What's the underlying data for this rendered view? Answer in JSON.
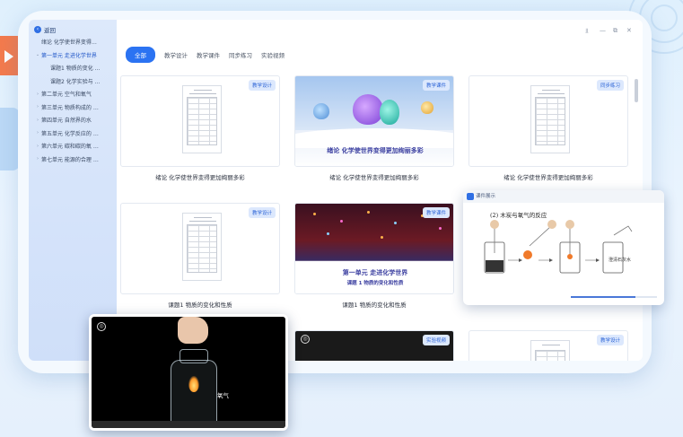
{
  "sidebar": {
    "back_label": "返回",
    "items": [
      {
        "label": "绪论 化学使世界变得…",
        "arrow": "",
        "active": false
      },
      {
        "label": "第一单元 走进化学世界",
        "arrow": "⌄",
        "active": true
      },
      {
        "label": "课题1 物质的变化 …",
        "arrow": "",
        "active": false
      },
      {
        "label": "课题2 化学实验与 …",
        "arrow": "",
        "active": false
      },
      {
        "label": "第二单元 空气和氧气",
        "arrow": "›",
        "active": false
      },
      {
        "label": "第三单元 物质构成的 …",
        "arrow": "›",
        "active": false
      },
      {
        "label": "第四单元 自然界的水",
        "arrow": "›",
        "active": false
      },
      {
        "label": "第五单元 化学反应的 …",
        "arrow": "›",
        "active": false
      },
      {
        "label": "第六单元 碳和碳的氧 …",
        "arrow": "›",
        "active": false
      },
      {
        "label": "第七单元 能源的合理 …",
        "arrow": "›",
        "active": false
      }
    ]
  },
  "window_controls": {
    "pin": "⫫",
    "minimize": "—",
    "restore": "⧉",
    "close": "✕"
  },
  "tabs": [
    "全部",
    "教学设计",
    "教学课件",
    "同步练习",
    "实验视频"
  ],
  "cards": [
    {
      "tag": "教学设计",
      "title": "绪论 化学使世界变得更加绚丽多彩"
    },
    {
      "tag": "教学课件",
      "title": "绪论 化学使世界变得更加绚丽多彩",
      "banner": "绪论  化学使世界变得更加绚丽多彩"
    },
    {
      "tag": "同步练习",
      "title": "绪论 化学使世界变得更加绚丽多彩"
    },
    {
      "tag": "教学设计",
      "title": "课题1 物质的变化和性质"
    },
    {
      "tag": "教学课件",
      "title": "课题1 物质的变化和性质",
      "banner_main": "第一单元  走进化学世界",
      "banner_sub": "课题 1   物质的变化和性质"
    },
    {
      "tag": "",
      "title": ""
    },
    {
      "tag": "",
      "title": ""
    },
    {
      "tag": "实验视频",
      "title": ""
    },
    {
      "tag": "教学设计",
      "title": ""
    }
  ],
  "popup_right": {
    "header": "课件展示",
    "subtitle": "(2) 木炭与氧气的反应",
    "label": "澄清石灰水",
    "progress": 0.75
  },
  "popup_left": {
    "label": "氧气"
  },
  "colors": {
    "accent": "#2b73f2",
    "sidebar_bg": "#d6e4fa",
    "tag_bg": "#dce8fd"
  }
}
